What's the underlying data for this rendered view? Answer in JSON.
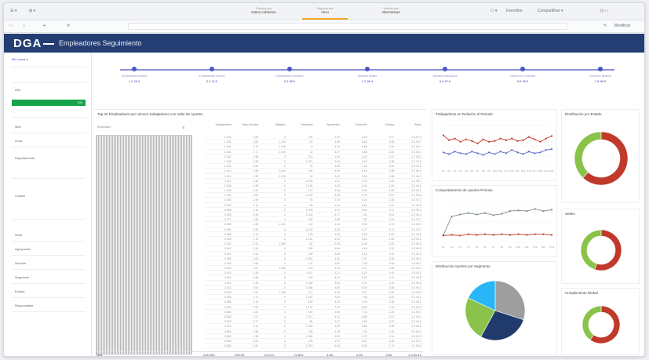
{
  "browser": {
    "tabs": [
      {
        "line1": "Primeira aba",
        "line2": "Datos cubiertos"
      },
      {
        "line1": "Segunda aba",
        "line2": "Ativo"
      },
      {
        "line1": "Terceira aba",
        "line2": "Alternativas"
      }
    ],
    "toolbar_right": "Favoritos",
    "toolbar_right2": "Compartilhar ▾",
    "edit_label": "Modificar"
  },
  "app": {
    "logo": "DGA",
    "title": "Empleadores Seguimiento"
  },
  "left_panel": {
    "selector": "Mis vistas ▾",
    "items": [
      "Año",
      "Mes",
      "Zona",
      "Departamento",
      "Ciudad",
      "Sede",
      "Agrupación",
      "Sección",
      "Segmento",
      "Estado",
      "Responsable"
    ],
    "green_value": "100"
  },
  "kpi": {
    "points": [
      {
        "caption": "Empleadores activos",
        "value": "1.2  45.0"
      },
      {
        "caption": "Empleadores nuevos",
        "value": "3.4  12.0"
      },
      {
        "caption": "Empleadores retirados",
        "value": "0.2  98.0"
      },
      {
        "caption": "Afiliados totales",
        "value": "1.0  48.4"
      },
      {
        "caption": "Aportes recaudados",
        "value": "3.4  87.8"
      },
      {
        "caption": "Cartera por recaudar",
        "value": "3.6  45.2"
      },
      {
        "caption": "Indicador general",
        "value": "1.8  89.6"
      }
    ]
  },
  "table": {
    "title": "Top 20 Empleadores por número trabajadores con Valor de Aportes",
    "dim_header": "Empleador",
    "columns": [
      "Trabajadores",
      "Valor Aportes",
      "Afiliados",
      "Retirados",
      "Aportantes",
      "Promedio",
      "Cartera",
      "Saldo"
    ],
    "rows": [
      [
        "1.044",
        "2.60",
        "0",
        "194",
        "2.12",
        "6.53",
        "0.17",
        "2.5 92.9"
      ],
      [
        "1.041",
        "1.82",
        "1.143",
        "15",
        "4.56",
        "8.82",
        "2.98",
        "2.3 94.7"
      ],
      [
        "1.041",
        "1.79",
        "1.128",
        "5",
        "3.74",
        "9.66",
        "2.34",
        "2.2 95.1"
      ],
      [
        "1.034",
        "2.71",
        "1.069",
        "12",
        "4.07",
        "5.88",
        "1.84",
        "2.4 96.4"
      ],
      [
        "1.031",
        "1.58",
        "2",
        "213",
        "1.52",
        "6.42",
        "1.22",
        "2.1 93.3"
      ],
      [
        "1.028",
        "2.26",
        "0",
        "1.022",
        "3.96",
        "8.18",
        "1.98",
        "2.2 93.8"
      ],
      [
        "1.022",
        "2.60",
        "0",
        "31",
        "3.49",
        "7.45",
        "2.34",
        "2.5 94.2"
      ],
      [
        "1.019",
        "1.65",
        "1.044",
        "104",
        "4.59",
        "5.16",
        "1.88",
        "2.3 96.5"
      ],
      [
        "1.015",
        "2.30",
        "1.005",
        "14",
        "3.42",
        "9.06",
        "2.08",
        "2.2 96.9"
      ],
      [
        "1.011",
        "1.58",
        "0",
        "1.026",
        "1.87",
        "4.72",
        "1.84",
        "2.4 95.7"
      ],
      [
        "1.008",
        "1.85",
        "0",
        "1.134",
        "4.03",
        "8.40",
        "1.83",
        "2.3 94.6"
      ],
      [
        "1.003",
        "2.32",
        "0",
        "176",
        "3.15",
        "6.94",
        "1.62",
        "2.5 95.0"
      ],
      [
        "1.001",
        "1.83",
        "0",
        "1.003",
        "4.18",
        "8.79",
        "2.07",
        "2.2 95.5"
      ],
      [
        "1.000",
        "2.49",
        "0",
        "76",
        "3.76",
        "5.22",
        "2.36",
        "2.5 97.2"
      ],
      [
        "0.993",
        "1.70",
        "0",
        "95",
        "2.31",
        "6.56",
        "1.41",
        "2.2 95.8"
      ],
      [
        "0.988",
        "2.18",
        "0",
        "1.005",
        "4.41",
        "8.64",
        "2.01",
        "2.3 95.4"
      ],
      [
        "0.985",
        "2.49",
        "0",
        "1.026",
        "4.17",
        "7.34",
        "2.61",
        "2.3 94.4"
      ],
      [
        "0.972",
        "1.85",
        "0",
        "160",
        "3.68",
        "7.82",
        "2.44",
        "2.4 93.7"
      ],
      [
        "0.968",
        "2.38",
        "1.121",
        "122",
        "4.24",
        "5.91",
        "2.10",
        "2.3 94.0"
      ],
      [
        "0.962",
        "1.99",
        "0",
        "1.076",
        "3.53",
        "6.77",
        "1.74",
        "2.2 93.7"
      ],
      [
        "0.958",
        "2.11",
        "0",
        "178",
        "4.02",
        "8.26",
        "2.52",
        "2.4 94.5"
      ],
      [
        "0.955",
        "1.75",
        "0",
        "1.030",
        "4.39",
        "6.53",
        "1.69",
        "2.5 95.3"
      ],
      [
        "0.951",
        "2.24",
        "1.080",
        "82",
        "2.29",
        "8.46",
        "1.83",
        "2.3 92.8"
      ],
      [
        "0.947",
        "2.40",
        "0",
        "153",
        "3.64",
        "4.65",
        "2.33",
        "2.5 95.8"
      ],
      [
        "0.941",
        "1.94",
        "0",
        "168",
        "3.88",
        "9.14",
        "2.01",
        "2.3 93.2"
      ],
      [
        "0.938",
        "2.05",
        "0",
        "1.051",
        "4.30",
        "7.67",
        "2.28",
        "2.2 96.2"
      ],
      [
        "0.933",
        "2.59",
        "0",
        "137",
        "2.82",
        "7.30",
        "2.59",
        "2.4 94.7"
      ],
      [
        "0.929",
        "1.87",
        "1.033",
        "103",
        "3.10",
        "8.71",
        "1.83",
        "2.3 95.4"
      ],
      [
        "0.922",
        "2.33",
        "0",
        "1.011",
        "3.21",
        "6.20",
        "1.92",
        "2.5 93.0"
      ],
      [
        "0.919",
        "1.98",
        "0",
        "126",
        "4.31",
        "5.61",
        "2.12",
        "2.2 96.8"
      ],
      [
        "0.914",
        "2.15",
        "0",
        "1.032",
        "3.81",
        "9.21",
        "2.19",
        "2.4 95.6"
      ],
      [
        "0.911",
        "2.64",
        "0",
        "1.088",
        "4.50",
        "8.00",
        "2.46",
        "2.3 94.2"
      ],
      [
        "0.906",
        "1.91",
        "1.165",
        "113",
        "3.19",
        "5.37",
        "2.03",
        "2.4 95.5"
      ],
      [
        "0.903",
        "1.72",
        "0",
        "1.040",
        "3.82",
        "7.96",
        "1.82",
        "2.2 93.6"
      ],
      [
        "0.898",
        "2.19",
        "0",
        "180",
        "4.23",
        "6.49",
        "2.28",
        "2.3 94.1"
      ],
      [
        "0.894",
        "2.52",
        "0",
        "1.122",
        "2.72",
        "8.84",
        "1.94",
        "2.5 95.9"
      ],
      [
        "0.889",
        "1.81",
        "0",
        "149",
        "3.90",
        "7.11",
        "2.20",
        "2.3 96.1"
      ],
      [
        "0.883",
        "2.27",
        "0",
        "1.017",
        "4.42",
        "6.85",
        "2.07",
        "2.4 93.9"
      ],
      [
        "0.878",
        "2.47",
        "0",
        "65",
        "3.47",
        "8.53",
        "2.37",
        "2.2 94.8"
      ],
      [
        "0.874",
        "2.12",
        "0",
        "1.059",
        "3.09",
        "5.88",
        "1.98",
        "2.3 95.2"
      ],
      [
        "0.869",
        "1.96",
        "0",
        "159",
        "4.18",
        "7.43",
        "2.15",
        "2.2 96.0"
      ],
      [
        "0.864",
        "2.36",
        "0",
        "1.046",
        "3.63",
        "6.72",
        "2.31",
        "2.5 92.9"
      ],
      [
        "0.859",
        "2.01",
        "0",
        "136",
        "2.97",
        "8.37",
        "2.05",
        "2.4 94.2"
      ],
      [
        "0.852",
        "2.20",
        "0",
        "1.013",
        "4.06",
        "6.08",
        "1.79",
        "2.2 95.8"
      ]
    ],
    "totals": [
      "Total",
      "225.399",
      "290.03",
      "13.214",
      "74.876",
      "1.83",
      "2.28",
      "3.06",
      "2.4  95.12"
    ]
  },
  "charts": {
    "line1_title": "Trabajadores en Relación al Periodo",
    "line2_title": "Comportamiento de Aportes Periodo",
    "pie_title": "Distribución Aportes por Segmento",
    "donut1_title": "Distribución por Estado",
    "donut2_title": "Sedes",
    "donut3_title": "Cumplimiento Global"
  },
  "chart_data": [
    {
      "type": "line",
      "x": [
        "P1",
        "P2",
        "P3",
        "P4",
        "P5",
        "P6",
        "P7",
        "P8",
        "P9",
        "P10",
        "P11",
        "P12",
        "P13",
        "P14",
        "P15",
        "P16",
        "P17",
        "P18",
        "P19",
        "P20"
      ],
      "series": [
        {
          "values": [
            3.8,
            3.2,
            3.4,
            3.0,
            3.3,
            3.1,
            2.8,
            3.3,
            3.0,
            3.1,
            3.4,
            3.2,
            3.4,
            3.1,
            3.2,
            3.6,
            3.3,
            3.0,
            3.4,
            3.7
          ],
          "color": "#c0392b"
        },
        {
          "values": [
            1.7,
            1.5,
            1.8,
            1.6,
            1.5,
            1.8,
            1.6,
            1.4,
            1.7,
            1.5,
            1.8,
            1.6,
            2.0,
            1.7,
            1.5,
            1.8,
            1.6,
            1.7,
            2.0,
            2.1
          ],
          "color": "#5a6bc9"
        }
      ],
      "ylim": [
        0,
        5
      ]
    },
    {
      "type": "line",
      "x": [
        "P1",
        "P2",
        "P3",
        "P4",
        "P5",
        "P6",
        "P7",
        "P8",
        "P9",
        "P10",
        "P11",
        "P12",
        "P13",
        "P14"
      ],
      "series": [
        {
          "values": [
            1.1,
            3.8,
            4.1,
            4.3,
            4.1,
            4.3,
            4.0,
            4.2,
            4.6,
            4.7,
            4.6,
            4.9,
            4.6,
            4.8
          ],
          "color": "#7f8c8d"
        },
        {
          "values": [
            1.0,
            1.1,
            1.0,
            1.2,
            1.1,
            1.2,
            1.1,
            1.2,
            1.1,
            1.2,
            1.1,
            1.2,
            1.2,
            1.1
          ],
          "color": "#c0392b"
        }
      ],
      "ylim": [
        0,
        6
      ]
    },
    {
      "type": "pie",
      "labels": [
        "A",
        "B",
        "C",
        "D"
      ],
      "values": [
        30,
        28,
        24,
        18
      ],
      "colors": [
        "#9e9e9e",
        "#1f3a6b",
        "#8bc34a",
        "#29b6f6"
      ]
    },
    {
      "type": "pie",
      "labels": [
        "Activo",
        "Inactivo"
      ],
      "values": [
        0.62,
        0.38
      ],
      "colors": [
        "#c0392b",
        "#8bc34a"
      ]
    },
    {
      "type": "pie",
      "labels": [
        "Sede A",
        "Sede B"
      ],
      "values": [
        0.55,
        0.45
      ],
      "colors": [
        "#c0392b",
        "#8bc34a"
      ]
    },
    {
      "type": "pie",
      "labels": [
        "Cumplido",
        "Pendiente"
      ],
      "values": [
        0.6,
        0.4
      ],
      "colors": [
        "#c0392b",
        "#8bc34a"
      ]
    }
  ]
}
